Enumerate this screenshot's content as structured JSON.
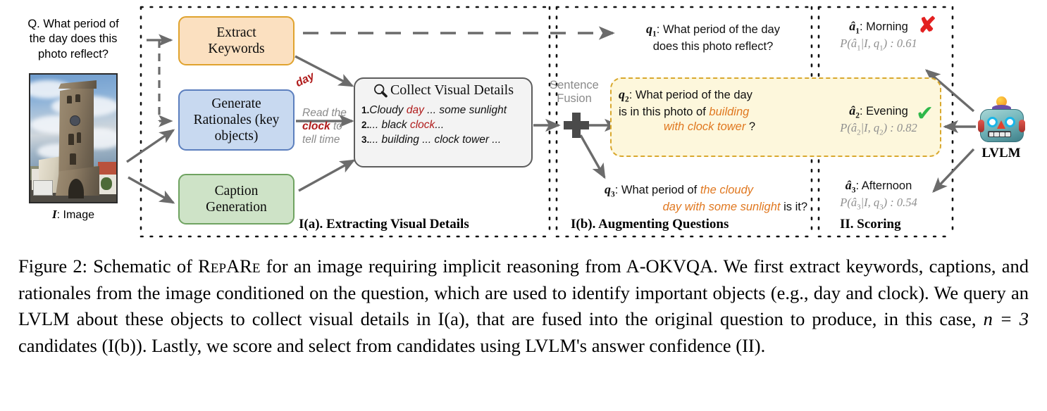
{
  "input": {
    "question_label": "Q.",
    "question_text": "Q. What period of\nthe day does this\nphoto reflect?",
    "question_line1": "Q. What period of",
    "question_line2": "the day does this",
    "question_line3": "photo reflect?",
    "image_caption_symbol": "I",
    "image_caption_rest": ": Image"
  },
  "modules": [
    {
      "id": "extract-keywords",
      "line1": "Extract",
      "line2": "Keywords",
      "color": "#fbe0c0",
      "border": "#e0a32e"
    },
    {
      "id": "generate-rationales",
      "line1": "Generate",
      "line2": "Rationales (key",
      "line3": "objects)",
      "color": "#c8d9f0",
      "border": "#5c7fbe"
    },
    {
      "id": "caption-generation",
      "line1": "Caption",
      "line2": "Generation",
      "color": "#cee3c7",
      "border": "#6fa361"
    }
  ],
  "edge_labels": {
    "keyword_day": "day",
    "rationale_line1": "Read the",
    "rationale_kw": "clock",
    "rationale_line2_tail": " to",
    "rationale_line3": "tell time"
  },
  "collect_panel": {
    "icon": "magnifier-icon",
    "title": "Collect Visual Details",
    "items": [
      {
        "num": "1.",
        "pre": "Cloudy ",
        "kw": "day",
        "post": " ... some sunlight"
      },
      {
        "num": "2.",
        "pre": "... black ",
        "kw": "clock",
        "post": "..."
      },
      {
        "num": "3.",
        "pre": "... building ... clock tower ...",
        "kw": "",
        "post": ""
      }
    ]
  },
  "fusion": {
    "line1": "Sentence",
    "line2": "Fusion",
    "operator": "+"
  },
  "questions": [
    {
      "label": "q",
      "sub": "1",
      "line1_plain": ": What period of the day",
      "line2_plain": "does this photo reflect?",
      "highlighted": false
    },
    {
      "label": "q",
      "sub": "2",
      "line1_plain": ": What period of the day",
      "line2_plain": "is in this photo of ",
      "line2_hl": "building",
      "line3_hl": "with clock tower",
      "line3_plain": " ?",
      "highlighted": true
    },
    {
      "label": "q",
      "sub": "3",
      "line1_plain": ": What period of ",
      "line1_hl": "the cloudy",
      "line2_hl": "day with some sunlight",
      "line2_plain": " is it?",
      "highlighted": false
    }
  ],
  "answers": [
    {
      "label": "a",
      "sub": "1",
      "text": ": Morning",
      "prob_expr": "P(â₁|I, q₁) : 0.61",
      "prob_prefix": "P(â",
      "prob_sub1": "1",
      "prob_mid": "|I, q",
      "prob_sub2": "1",
      "prob_suffix": ") : 0.61",
      "score": "0.61",
      "mark": "incorrect",
      "mark_glyph": "✘"
    },
    {
      "label": "a",
      "sub": "2",
      "text": ": Evening",
      "prob_expr": "P(â₂|I, q₂) : 0.82",
      "prob_prefix": "P(â",
      "prob_sub1": "2",
      "prob_mid": "|I, q",
      "prob_sub2": "2",
      "prob_suffix": ") : 0.82",
      "score": "0.82",
      "mark": "correct",
      "mark_glyph": "✔"
    },
    {
      "label": "a",
      "sub": "3",
      "text": ": Afternoon",
      "prob_expr": "P(â₃|I, q₃) : 0.54",
      "prob_prefix": "P(â",
      "prob_sub1": "3",
      "prob_mid": "|I, q",
      "prob_sub2": "3",
      "prob_suffix": ") : 0.54",
      "score": "0.54",
      "mark": "none",
      "mark_glyph": ""
    }
  ],
  "model": {
    "icon": "robot-icon",
    "label": "LVLM"
  },
  "sections": [
    {
      "id": "section-ia",
      "label": "I(a). Extracting Visual Details"
    },
    {
      "id": "section-ib",
      "label": "I(b). Augmenting Questions"
    },
    {
      "id": "section-ii",
      "label": "II. Scoring"
    }
  ],
  "caption": {
    "prefix": "Figure 2:  Schematic of ",
    "smallcaps": "RepARe",
    "part2": " for an image requiring implicit reasoning from A-OKVQA. We first extract keywords, captions, and rationales from the image conditioned on the question, which are used to identify important objects (e.g., day and clock). We query an LVLM about these objects to collect visual details in I(a), that are fused into the original question to produce, in this case, ",
    "math": "n = 3",
    "part3": " candidates (I(b)). Lastly, we score and select from candidates using LVLM's answer confidence (II)."
  },
  "colors": {
    "keyword_red": "#b01b1b",
    "highlight_orange": "#e07820",
    "band_fill": "#fdf7dc",
    "band_border": "#d9a82e",
    "arrow_gray": "#6b6b6b",
    "muted_gray": "#8f8f8f",
    "correct_green": "#2fb84a",
    "incorrect_red": "#e32020"
  }
}
